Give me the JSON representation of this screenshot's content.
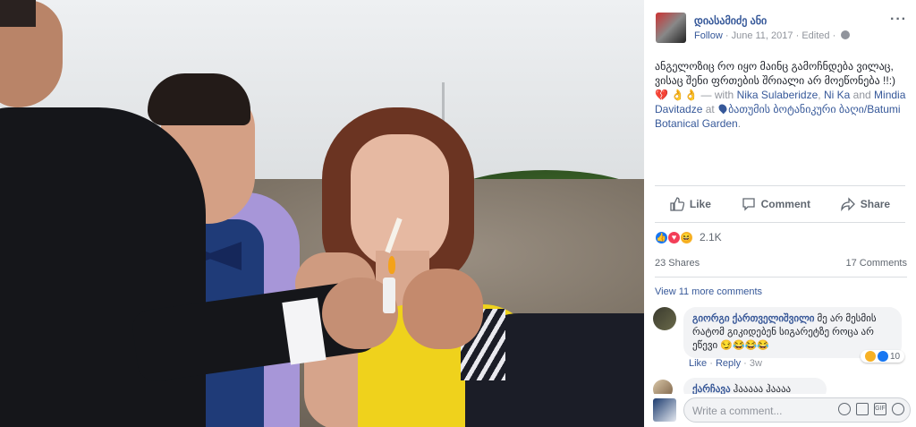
{
  "post": {
    "author": "დიასამიძე ანი",
    "follow_label": "Follow",
    "date": "June 11, 2017",
    "edited_label": "Edited",
    "caption": {
      "text": "ანგელოზიც რო იყო მაინც გამოჩნდება ვილაც, ვისაც შენი ფრთების შრიალი არ მოეწონება !!:)",
      "emoji_heart": "💔",
      "emoji_hands": "👌👌",
      "with_prefix": "— with",
      "tag1": "Nika Sulaberidze",
      "sep1": ",",
      "tag2": "Ni Ka",
      "and_label": "and",
      "tag3": "Mindia Davitadze",
      "at_label": "at",
      "place": "ბათუმის ბოტანიკური ბაღი/Batumi Botanical Garden",
      "end": "."
    },
    "actions": {
      "like": "Like",
      "comment": "Comment",
      "share": "Share"
    },
    "reaction_count": "2.1K",
    "shares": "23 Shares",
    "comments_count": "17 Comments",
    "view_more": "View 11 more comments"
  },
  "comments": [
    {
      "name": "გიორგი ქართველიშვილი",
      "text": "მე არ მესმის რატომ გიკიდებენ სიგარეტზე როცა არ ეწევი",
      "emojis": "😏😂😂😂",
      "like": "Like",
      "reply": "Reply",
      "time": "3w",
      "reaction_count": "10"
    },
    {
      "name": "ქარჩავა",
      "text": "ჰააააა ჰაააა"
    }
  ],
  "composer": {
    "placeholder": "Write a comment...",
    "icons": [
      "emoji-icon",
      "camera-icon",
      "gif-icon",
      "sticker-icon"
    ]
  },
  "colors": {
    "link": "#365899",
    "muted": "#90949c",
    "like": "#1877f2",
    "love": "#f33e58",
    "haha": "#f7b125"
  }
}
